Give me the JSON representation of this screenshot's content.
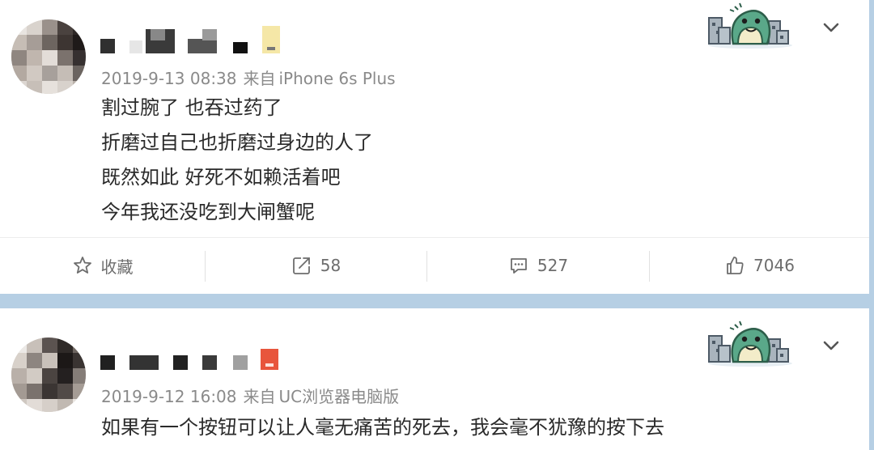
{
  "posts": [
    {
      "meta": {
        "timestamp": "2019-9-13 08:38",
        "source_prefix": "来自",
        "source": "iPhone 6s Plus"
      },
      "lines": [
        "割过腕了 也吞过药了",
        "折磨过自己也折磨过身边的人了",
        "既然如此 好死不如赖活着吧",
        "今年我还没吃到大闸蟹呢"
      ],
      "actions": {
        "favorite": "收藏",
        "repost": "58",
        "comment": "527",
        "like": "7046"
      }
    },
    {
      "meta": {
        "timestamp": "2019-9-12 16:08",
        "source_prefix": "来自",
        "source": "UC浏览器电脑版"
      },
      "lines": [
        "如果有一个按钮可以让人毫无痛苦的死去，我会毫不犹豫的按下去"
      ]
    }
  ],
  "colors": {
    "page_bg": "#b6cfe4",
    "card_bg": "#ffffff",
    "meta_text": "#8a8a8a",
    "action_text": "#6d6d6d",
    "badge_dino": "#5aa889"
  }
}
